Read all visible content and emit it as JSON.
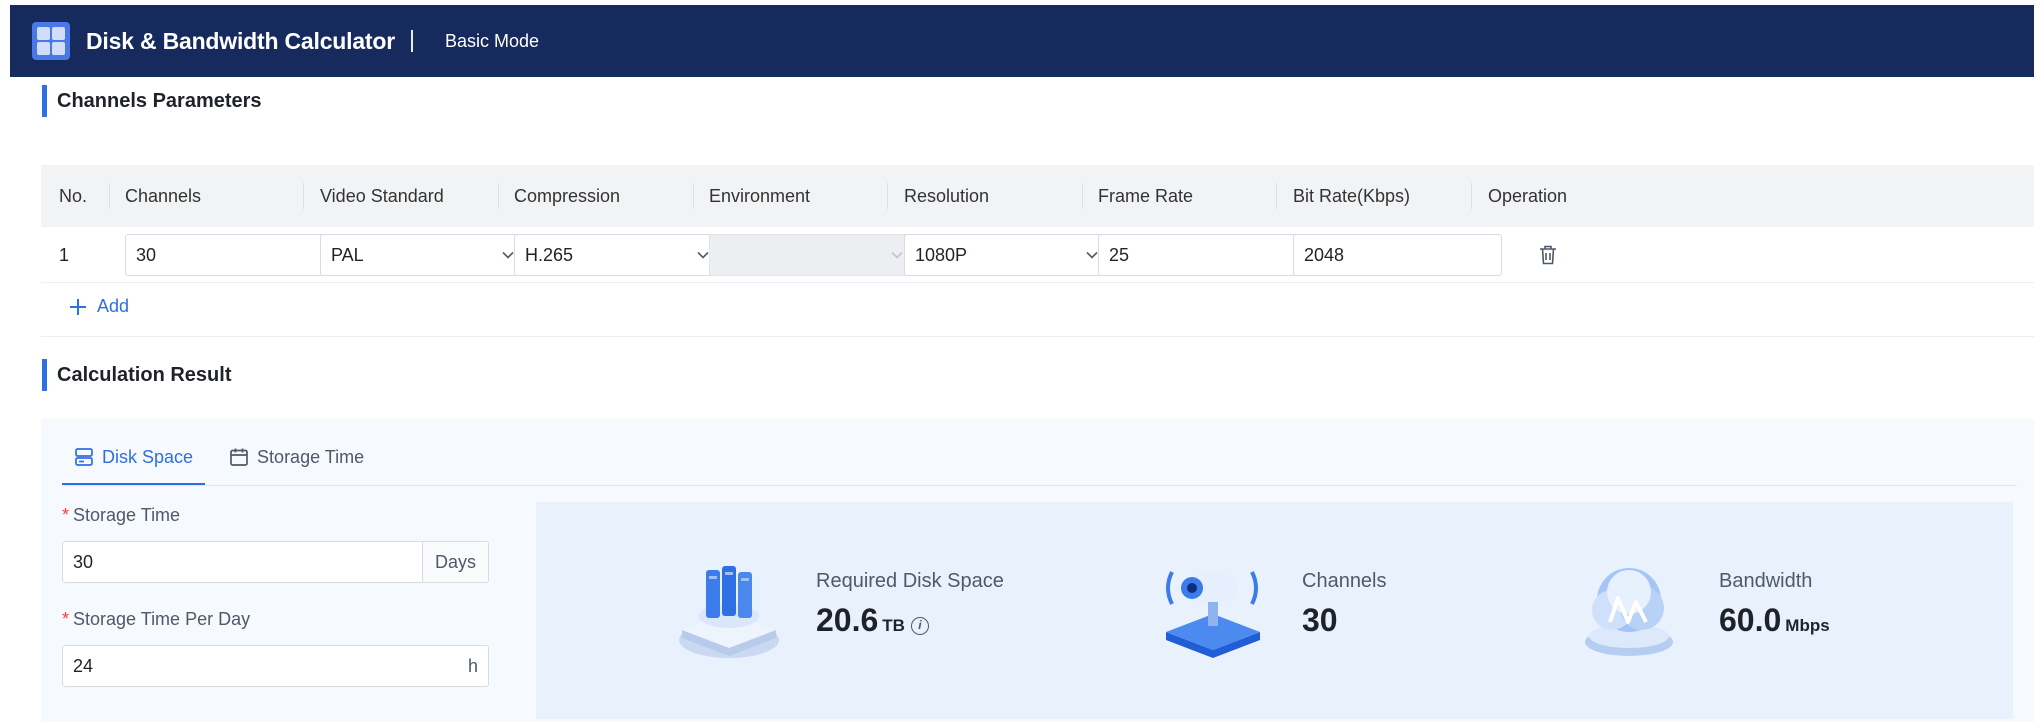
{
  "header": {
    "title": "Disk & Bandwidth Calculator",
    "mode": "Basic Mode"
  },
  "channels_section": {
    "title": "Channels Parameters",
    "columns": [
      "No.",
      "Channels",
      "Video Standard",
      "Compression",
      "Environment",
      "Resolution",
      "Frame Rate",
      "Bit Rate(Kbps)",
      "Operation"
    ],
    "rows": [
      {
        "no": "1",
        "channels": "30",
        "video_standard": "PAL",
        "compression": "H.265",
        "environment": "",
        "resolution": "1080P",
        "frame_rate": "25",
        "bit_rate": "2048"
      }
    ],
    "add_label": "Add"
  },
  "result_section": {
    "title": "Calculation Result",
    "tabs": [
      {
        "label": "Disk Space",
        "icon": "disk-icon",
        "active": true
      },
      {
        "label": "Storage Time",
        "icon": "calendar-icon",
        "active": false
      }
    ],
    "form": {
      "storage_time_label": "Storage Time",
      "storage_time_value": "30",
      "storage_time_unit": "Days",
      "per_day_label": "Storage Time Per Day",
      "per_day_value": "24",
      "per_day_unit": "h"
    },
    "stats": {
      "disk_label": "Required Disk Space",
      "disk_value": "20.6",
      "disk_unit": "TB",
      "channels_label": "Channels",
      "channels_value": "30",
      "bandwidth_label": "Bandwidth",
      "bandwidth_value": "60.0",
      "bandwidth_unit": "Mbps"
    }
  },
  "colors": {
    "header_bg": "#172a5e",
    "accent": "#2f6fe4",
    "required": "#f53f3f"
  }
}
